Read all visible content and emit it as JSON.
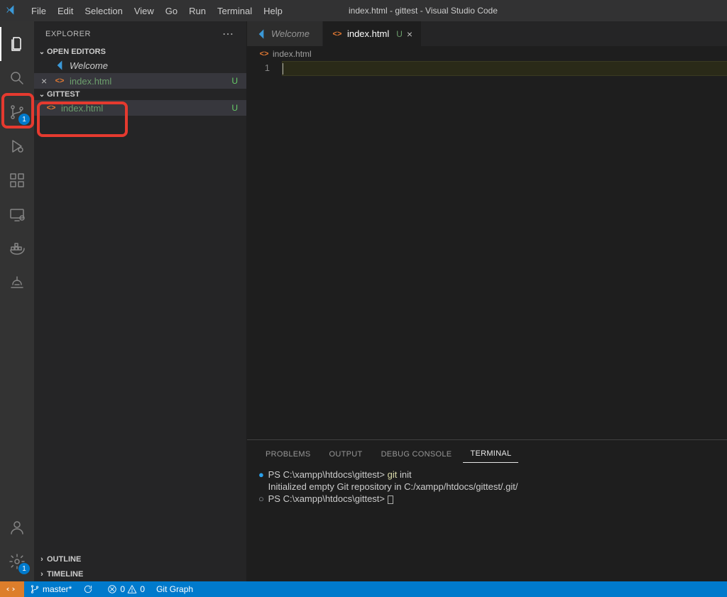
{
  "menubar": {
    "items": [
      "File",
      "Edit",
      "Selection",
      "View",
      "Go",
      "Run",
      "Terminal",
      "Help"
    ],
    "title": "index.html - gittest - Visual Studio Code"
  },
  "activitybar": {
    "source_control_badge": "1",
    "settings_badge": "1"
  },
  "sidebar": {
    "title": "EXPLORER",
    "open_editors": {
      "label": "OPEN EDITORS",
      "items": [
        {
          "label": "Welcome",
          "kind": "welcome"
        },
        {
          "label": "index.html",
          "kind": "html",
          "status": "U"
        }
      ]
    },
    "workspace": {
      "label": "GITTEST",
      "items": [
        {
          "label": "index.html",
          "kind": "html",
          "status": "U"
        }
      ]
    },
    "outline_label": "OUTLINE",
    "timeline_label": "TIMELINE"
  },
  "tabs": {
    "items": [
      {
        "label": "Welcome",
        "kind": "welcome",
        "italic": true
      },
      {
        "label": "index.html",
        "kind": "html",
        "dirty": "U",
        "active": true
      }
    ]
  },
  "breadcrumb": {
    "label": "index.html"
  },
  "editor": {
    "line_number": "1"
  },
  "panel": {
    "tabs": [
      "PROBLEMS",
      "OUTPUT",
      "DEBUG CONSOLE",
      "TERMINAL"
    ],
    "active_tab_index": 3,
    "terminal": {
      "line1_prefix": "PS C:\\xampp\\htdocs\\gittest> ",
      "line1_cmd_kw": "git",
      "line1_cmd_rest": " init",
      "line2": "Initialized empty Git repository in C:/xampp/htdocs/gittest/.git/",
      "line3_prefix": "PS C:\\xampp\\htdocs\\gittest> "
    }
  },
  "statusbar": {
    "branch": "master*",
    "errors": "0",
    "warnings": "0",
    "git_graph": "Git Graph"
  }
}
